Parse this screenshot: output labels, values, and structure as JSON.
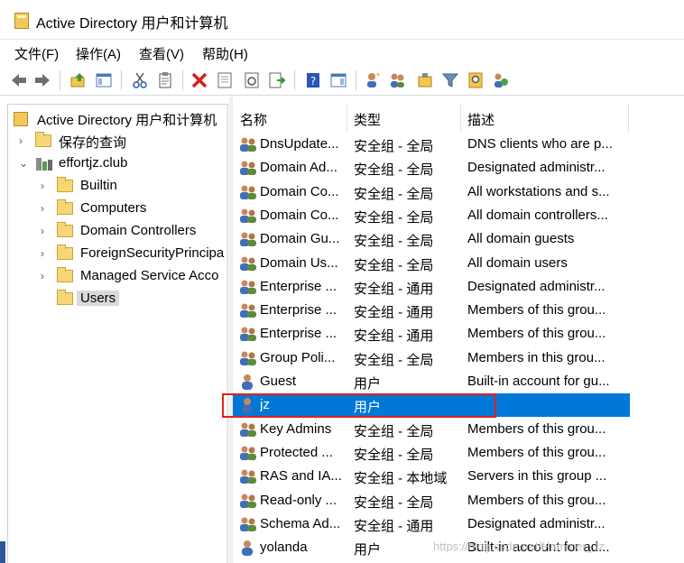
{
  "window": {
    "title": "Active Directory 用户和计算机"
  },
  "menu": [
    {
      "label": "文件(F)"
    },
    {
      "label": "操作(A)"
    },
    {
      "label": "查看(V)"
    },
    {
      "label": "帮助(H)"
    }
  ],
  "toolbar": {
    "buttons": [
      "back-icon",
      "forward-icon",
      "up-icon",
      "console-tree-icon",
      "cut-icon",
      "paste-icon",
      "delete-icon",
      "properties-icon",
      "refresh-icon",
      "export-icon",
      "help-icon",
      "show-pane-icon",
      "new-user-icon",
      "new-group-icon",
      "new-ou-icon",
      "filter-icon",
      "find-icon",
      "add-to-group-icon"
    ]
  },
  "tree": {
    "root": "Active Directory 用户和计算机",
    "saved_queries": "保存的查询",
    "domain": "effortjz.club",
    "children": [
      {
        "label": "Builtin"
      },
      {
        "label": "Computers"
      },
      {
        "label": "Domain Controllers"
      },
      {
        "label": "ForeignSecurityPrincipa"
      },
      {
        "label": "Managed Service Acco"
      },
      {
        "label": "Users",
        "selected": true
      }
    ]
  },
  "list": {
    "columns": [
      "名称",
      "类型",
      "描述"
    ],
    "rows": [
      {
        "icon": "group",
        "name": "DnsUpdate...",
        "type": "安全组 - 全局",
        "desc": "DNS clients who are p..."
      },
      {
        "icon": "group",
        "name": "Domain Ad...",
        "type": "安全组 - 全局",
        "desc": "Designated administr..."
      },
      {
        "icon": "group",
        "name": "Domain Co...",
        "type": "安全组 - 全局",
        "desc": "All workstations and s..."
      },
      {
        "icon": "group",
        "name": "Domain Co...",
        "type": "安全组 - 全局",
        "desc": "All domain controllers..."
      },
      {
        "icon": "group",
        "name": "Domain Gu...",
        "type": "安全组 - 全局",
        "desc": "All domain guests"
      },
      {
        "icon": "group",
        "name": "Domain Us...",
        "type": "安全组 - 全局",
        "desc": "All domain users"
      },
      {
        "icon": "group",
        "name": "Enterprise ...",
        "type": "安全组 - 通用",
        "desc": "Designated administr..."
      },
      {
        "icon": "group",
        "name": "Enterprise ...",
        "type": "安全组 - 通用",
        "desc": "Members of this grou..."
      },
      {
        "icon": "group",
        "name": "Enterprise ...",
        "type": "安全组 - 通用",
        "desc": "Members of this grou..."
      },
      {
        "icon": "group",
        "name": "Group Poli...",
        "type": "安全组 - 全局",
        "desc": "Members in this grou..."
      },
      {
        "icon": "user",
        "name": "Guest",
        "type": "用户",
        "desc": "Built-in account for gu..."
      },
      {
        "icon": "user",
        "name": "jz",
        "type": "用户",
        "desc": "",
        "selected": true
      },
      {
        "icon": "group",
        "name": "Key Admins",
        "type": "安全组 - 全局",
        "desc": "Members of this grou..."
      },
      {
        "icon": "group",
        "name": "Protected ...",
        "type": "安全组 - 全局",
        "desc": "Members of this grou..."
      },
      {
        "icon": "group",
        "name": "RAS and IA...",
        "type": "安全组 - 本地域",
        "desc": "Servers in this group ..."
      },
      {
        "icon": "group",
        "name": "Read-only ...",
        "type": "安全组 - 全局",
        "desc": "Members of this grou..."
      },
      {
        "icon": "group",
        "name": "Schema Ad...",
        "type": "安全组 - 通用",
        "desc": "Designated administr..."
      },
      {
        "icon": "user",
        "name": "yolanda",
        "type": "用户",
        "desc": "Built-in account for ad..."
      }
    ]
  },
  "watermark": "https://blog.csdn.net/Hammer_Jz",
  "colors": {
    "selection": "#0078d7",
    "highlight_box": "#e02020"
  }
}
